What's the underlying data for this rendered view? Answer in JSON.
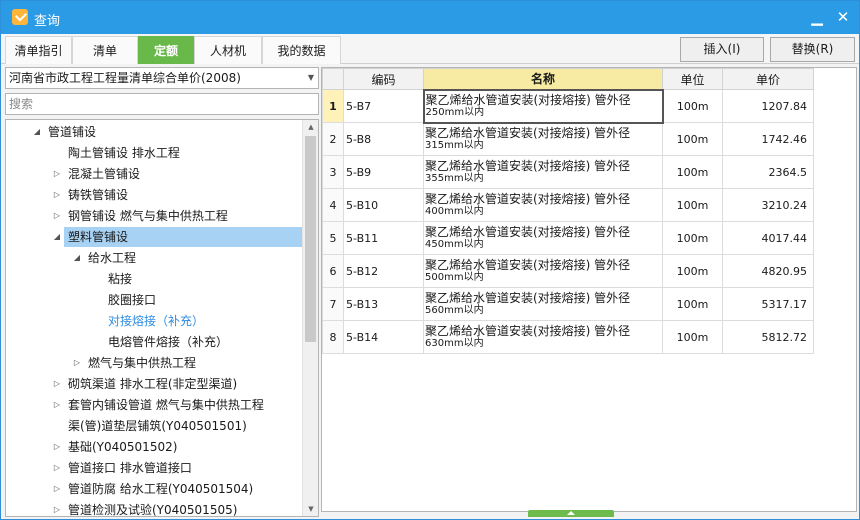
{
  "window": {
    "title": "查询"
  },
  "tabs": [
    {
      "label": "清单指引"
    },
    {
      "label": "清单"
    },
    {
      "label": "定额",
      "active": true
    },
    {
      "label": "人材机"
    },
    {
      "label": "我的数据"
    }
  ],
  "toolbar": {
    "insert_label": "插入(I)",
    "replace_label": "替换(R)"
  },
  "library": {
    "selected": "河南省市政工程工程量清单综合单价(2008)"
  },
  "search": {
    "placeholder": "搜索"
  },
  "tree": [
    {
      "label": "管道铺设",
      "toggle": "expanded"
    },
    {
      "label": "陶土管铺设 排水工程",
      "toggle": "none"
    },
    {
      "label": "混凝土管铺设",
      "toggle": "collapsed"
    },
    {
      "label": "铸铁管铺设",
      "toggle": "collapsed"
    },
    {
      "label": "钢管铺设 燃气与集中供热工程",
      "toggle": "collapsed"
    },
    {
      "label": "塑料管铺设",
      "toggle": "expanded",
      "selected": true
    },
    {
      "label": "给水工程",
      "toggle": "expanded"
    },
    {
      "label": "粘接",
      "toggle": "none"
    },
    {
      "label": "胶圈接口",
      "toggle": "none"
    },
    {
      "label": "对接熔接（补充）",
      "toggle": "none",
      "link": true
    },
    {
      "label": "电熔管件熔接（补充）",
      "toggle": "none"
    },
    {
      "label": "燃气与集中供热工程",
      "toggle": "collapsed"
    },
    {
      "label": "砌筑渠道 排水工程(非定型渠道)",
      "toggle": "collapsed"
    },
    {
      "label": "套管内铺设管道 燃气与集中供热工程",
      "toggle": "collapsed"
    },
    {
      "label": "渠(管)道垫层铺筑(Y040501501)",
      "toggle": "none"
    },
    {
      "label": "基础(Y040501502)",
      "toggle": "collapsed"
    },
    {
      "label": "管道接口 排水管道接口",
      "toggle": "collapsed"
    },
    {
      "label": "管道防腐 给水工程(Y040501504)",
      "toggle": "collapsed"
    },
    {
      "label": "管道检测及试验(Y040501505)",
      "toggle": "collapsed"
    }
  ],
  "grid": {
    "columns": [
      "编码",
      "名称",
      "单位",
      "单价"
    ],
    "rows": [
      {
        "idx": "1",
        "code": "5-B7",
        "name1": "聚乙烯给水管道安装(对接熔接) 管外径",
        "name2": "250mm以内",
        "unit": "100m",
        "price": "1207.84"
      },
      {
        "idx": "2",
        "code": "5-B8",
        "name1": "聚乙烯给水管道安装(对接熔接) 管外径",
        "name2": "315mm以内",
        "unit": "100m",
        "price": "1742.46"
      },
      {
        "idx": "3",
        "code": "5-B9",
        "name1": "聚乙烯给水管道安装(对接熔接) 管外径",
        "name2": "355mm以内",
        "unit": "100m",
        "price": "2364.5"
      },
      {
        "idx": "4",
        "code": "5-B10",
        "name1": "聚乙烯给水管道安装(对接熔接) 管外径",
        "name2": "400mm以内",
        "unit": "100m",
        "price": "3210.24"
      },
      {
        "idx": "5",
        "code": "5-B11",
        "name1": "聚乙烯给水管道安装(对接熔接) 管外径",
        "name2": "450mm以内",
        "unit": "100m",
        "price": "4017.44"
      },
      {
        "idx": "6",
        "code": "5-B12",
        "name1": "聚乙烯给水管道安装(对接熔接) 管外径",
        "name2": "500mm以内",
        "unit": "100m",
        "price": "4820.95"
      },
      {
        "idx": "7",
        "code": "5-B13",
        "name1": "聚乙烯给水管道安装(对接熔接) 管外径",
        "name2": "560mm以内",
        "unit": "100m",
        "price": "5317.17"
      },
      {
        "idx": "8",
        "code": "5-B14",
        "name1": "聚乙烯给水管道安装(对接熔接) 管外径",
        "name2": "630mm以内",
        "unit": "100m",
        "price": "5812.72"
      }
    ]
  },
  "colors": {
    "titlebar": "#2c9be6",
    "active_tab": "#69b94a",
    "selection": "#a8d2f4",
    "name_header": "#f7eba4"
  }
}
